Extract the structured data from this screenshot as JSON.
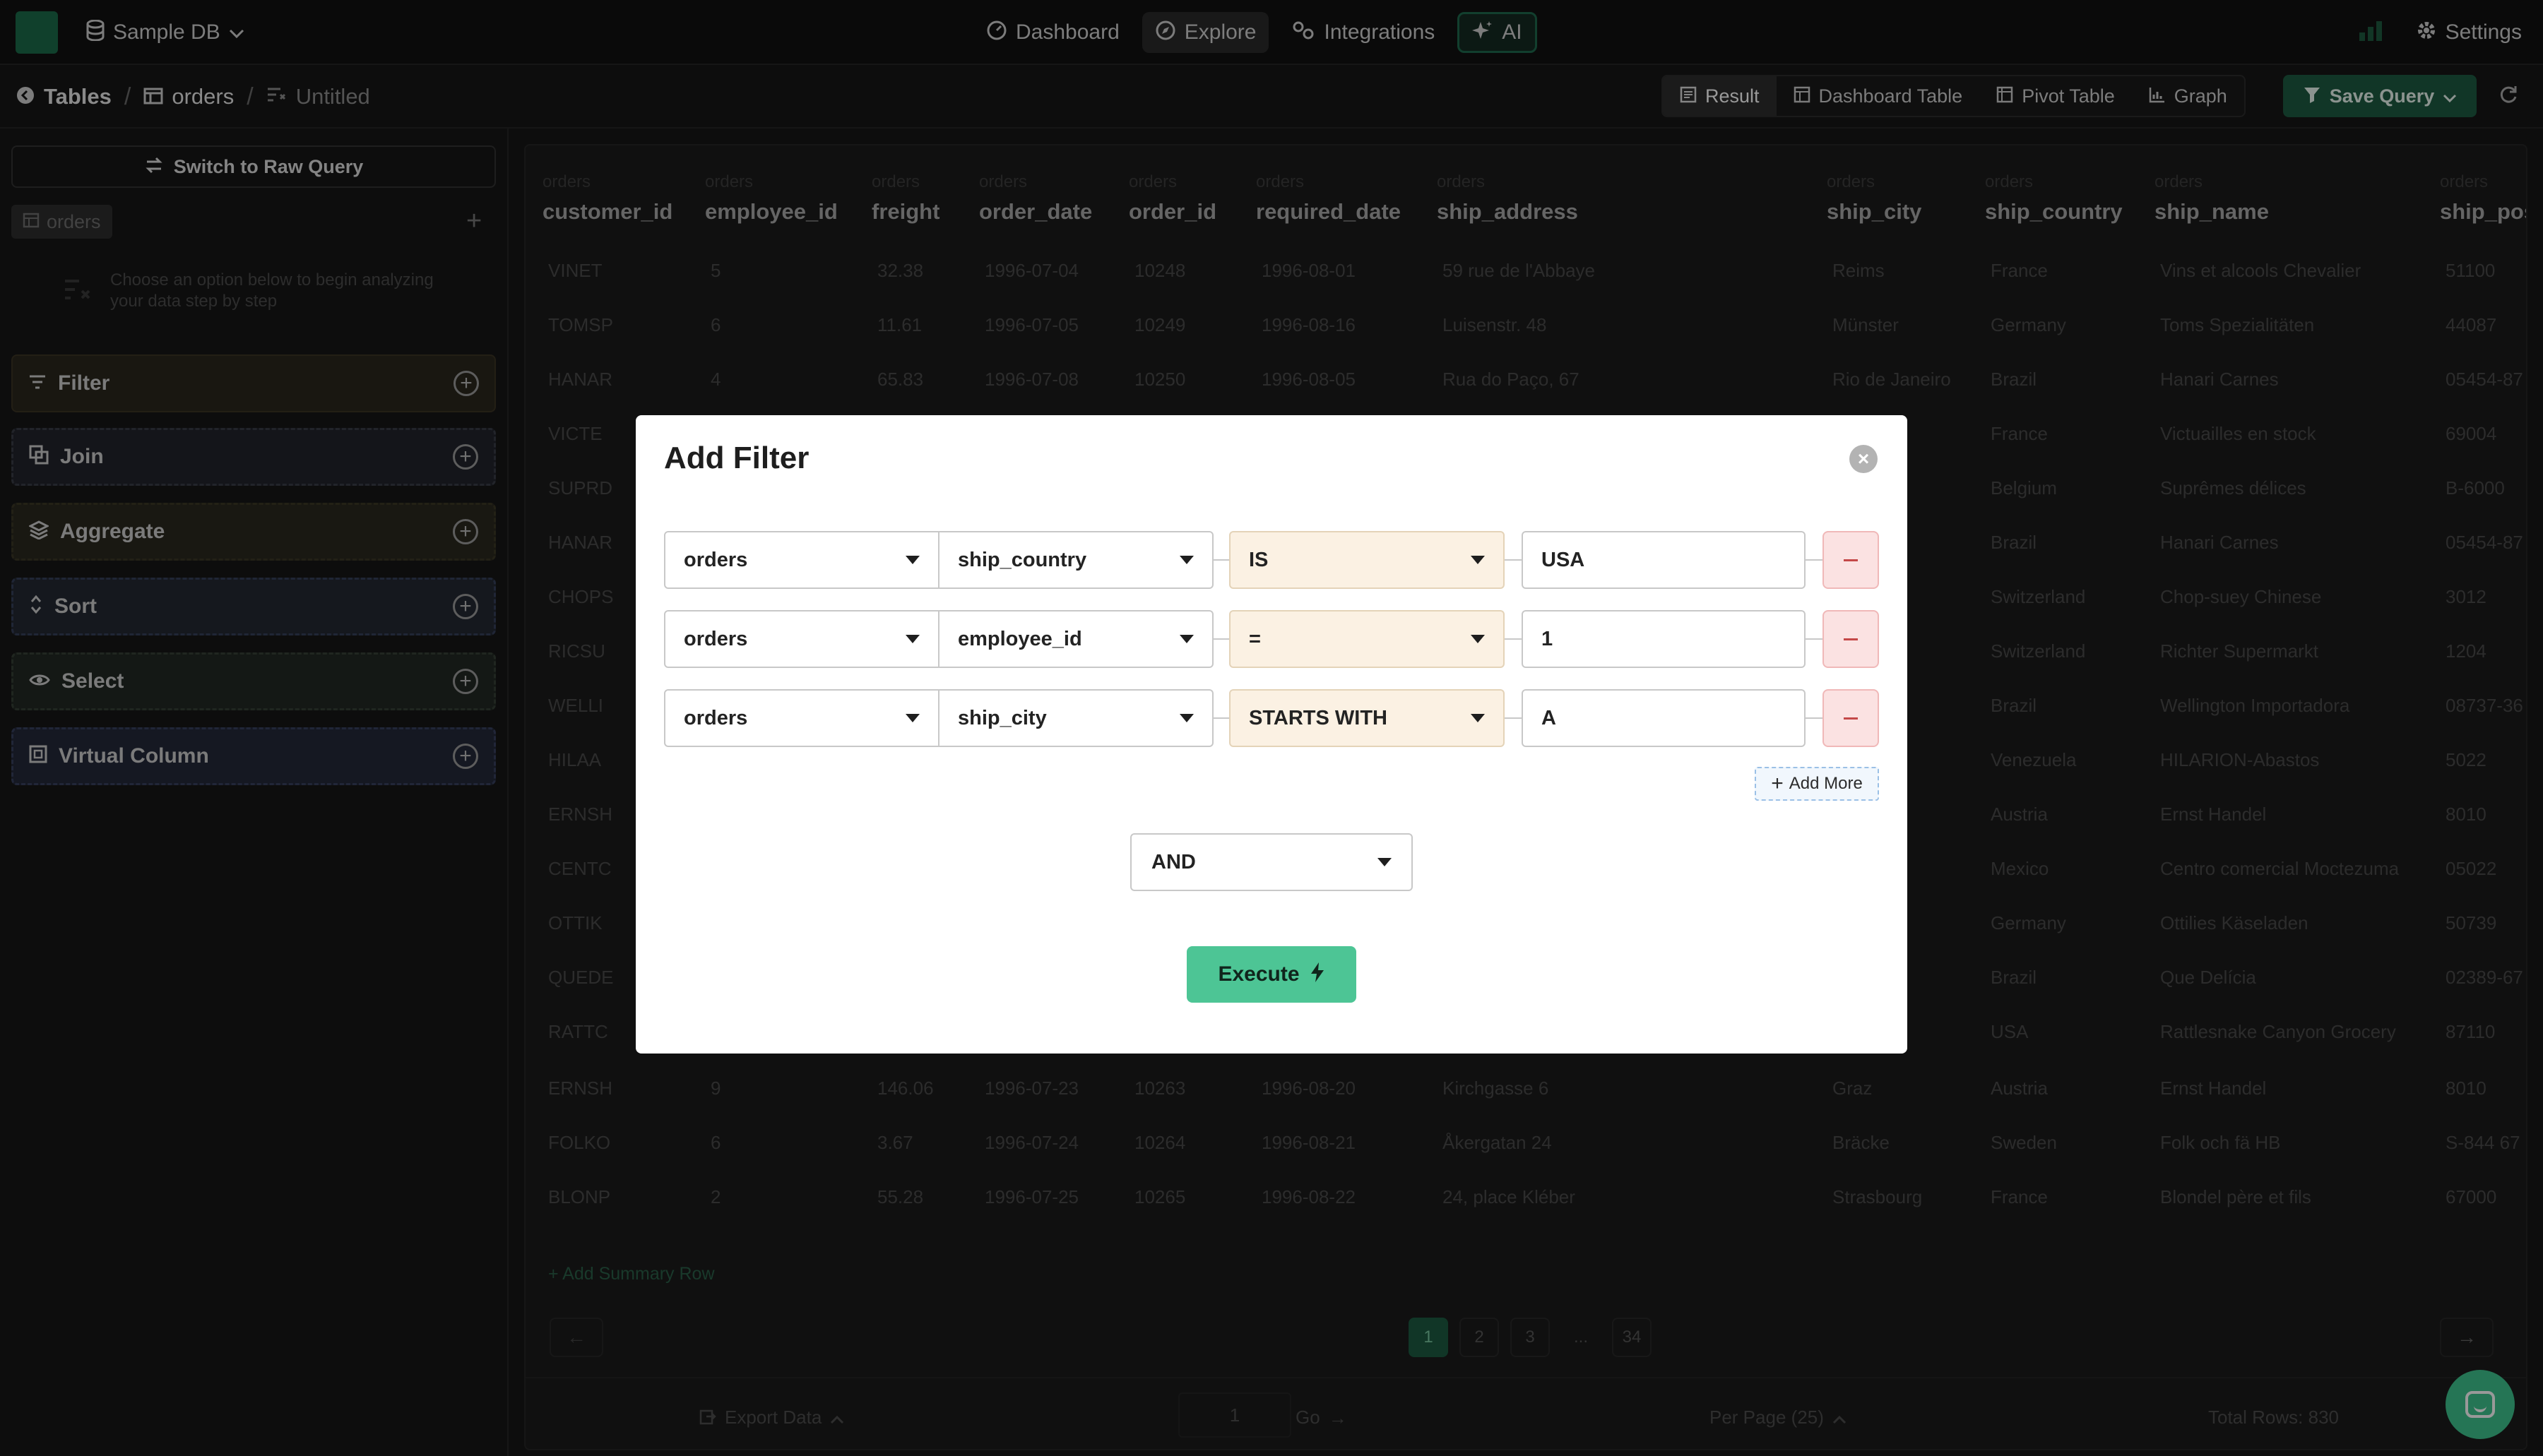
{
  "app": {
    "db_name": "Sample DB",
    "nav": [
      {
        "label": "Dashboard",
        "icon": "dashboard-icon"
      },
      {
        "label": "Explore",
        "icon": "compass-icon"
      },
      {
        "label": "Integrations",
        "icon": "integrations-icon"
      },
      {
        "label": "AI",
        "icon": "sparkle-icon"
      }
    ],
    "settings_label": "Settings"
  },
  "subheader": {
    "breadcrumb": [
      "Tables",
      "orders",
      "Untitled"
    ],
    "view_tabs": [
      "Result",
      "Dashboard Table",
      "Pivot Table",
      "Graph"
    ],
    "save_label": "Save Query"
  },
  "left_panel": {
    "raw_query_label": "Switch to Raw Query",
    "table_pill": "orders",
    "hint": "Choose an option below to begin analyzing your data step by step",
    "operations": [
      "Filter",
      "Join",
      "Aggregate",
      "Sort",
      "Select",
      "Virtual Column"
    ]
  },
  "table": {
    "source": "orders",
    "columns": [
      "customer_id",
      "employee_id",
      "freight",
      "order_date",
      "order_id",
      "required_date",
      "ship_address",
      "ship_city",
      "ship_country",
      "ship_name",
      "ship_pos"
    ],
    "rows": [
      [
        "VINET",
        "5",
        "32.38",
        "1996-07-04",
        "10248",
        "1996-08-01",
        "59 rue de l'Abbaye",
        "Reims",
        "France",
        "Vins et alcools Chevalier",
        "51100"
      ],
      [
        "TOMSP",
        "6",
        "11.61",
        "1996-07-05",
        "10249",
        "1996-08-16",
        "Luisenstr. 48",
        "Münster",
        "Germany",
        "Toms Spezialitäten",
        "44087"
      ],
      [
        "HANAR",
        "4",
        "65.83",
        "1996-07-08",
        "10250",
        "1996-08-05",
        "Rua do Paço, 67",
        "Rio de Janeiro",
        "Brazil",
        "Hanari Carnes",
        "05454-87"
      ],
      [
        "VICTE",
        "",
        "",
        "",
        "",
        "",
        "",
        "",
        "France",
        "Victuailles en stock",
        "69004"
      ],
      [
        "SUPRD",
        "",
        "",
        "",
        "",
        "",
        "",
        "",
        "Belgium",
        "Suprêmes délices",
        "B-6000"
      ],
      [
        "HANAR",
        "",
        "",
        "",
        "",
        "",
        "",
        "neiro",
        "Brazil",
        "Hanari Carnes",
        "05454-87"
      ],
      [
        "CHOPS",
        "",
        "",
        "",
        "",
        "",
        "",
        "",
        "Switzerland",
        "Chop-suey Chinese",
        "3012"
      ],
      [
        "RICSU",
        "",
        "",
        "",
        "",
        "",
        "",
        "",
        "Switzerland",
        "Richter Supermarkt",
        "1204"
      ],
      [
        "WELLI",
        "",
        "",
        "",
        "",
        "",
        "",
        "",
        "Brazil",
        "Wellington Importadora",
        "08737-36"
      ],
      [
        "HILAA",
        "",
        "",
        "",
        "",
        "",
        "",
        "bal",
        "Venezuela",
        "HILARION-Abastos",
        "5022"
      ],
      [
        "ERNSH",
        "",
        "",
        "",
        "",
        "",
        "",
        "",
        "Austria",
        "Ernst Handel",
        "8010"
      ],
      [
        "CENTC",
        "",
        "",
        "",
        "",
        "",
        "",
        "F.",
        "Mexico",
        "Centro comercial Moctezuma",
        "05022"
      ],
      [
        "OTTIK",
        "",
        "",
        "",
        "",
        "",
        "",
        "",
        "Germany",
        "Ottilies Käseladen",
        "50739"
      ],
      [
        "QUEDE",
        "",
        "",
        "",
        "",
        "",
        "",
        "neiro",
        "Brazil",
        "Que Delícia",
        "02389-67"
      ],
      [
        "RATTC",
        "",
        "",
        "",
        "",
        "",
        "",
        "que",
        "USA",
        "Rattlesnake Canyon Grocery",
        "87110"
      ],
      [
        "ERNSH",
        "9",
        "146.06",
        "1996-07-23",
        "10263",
        "1996-08-20",
        "Kirchgasse 6",
        "Graz",
        "Austria",
        "Ernst Handel",
        "8010"
      ],
      [
        "FOLKO",
        "6",
        "3.67",
        "1996-07-24",
        "10264",
        "1996-08-21",
        "Åkergatan 24",
        "Bräcke",
        "Sweden",
        "Folk och fä HB",
        "S-844 67"
      ],
      [
        "BLONP",
        "2",
        "55.28",
        "1996-07-25",
        "10265",
        "1996-08-22",
        "24, place Kléber",
        "Strasbourg",
        "France",
        "Blondel père et fils",
        "67000"
      ]
    ],
    "add_summary": "+ Add Summary Row",
    "pages": [
      "1",
      "2",
      "3",
      "...",
      "34"
    ],
    "export_label": "Export Data",
    "page_input": "1",
    "go_label": "Go",
    "per_page_label": "Per Page (25)",
    "total_rows_label": "Total Rows: 830"
  },
  "modal": {
    "title": "Add Filter",
    "filters": [
      {
        "table": "orders",
        "column": "ship_country",
        "operator": "IS",
        "value": "USA"
      },
      {
        "table": "orders",
        "column": "employee_id",
        "operator": "=",
        "value": "1"
      },
      {
        "table": "orders",
        "column": "ship_city",
        "operator": "STARTS WITH",
        "value": "A"
      }
    ],
    "add_more_label": "Add More",
    "logic": "AND",
    "execute_label": "Execute"
  },
  "colors": {
    "accent": "#4dc595",
    "brand_dark": "#1d5a41",
    "operator_bg": "#fbf1e3",
    "delete_bg": "#fbe2e2"
  }
}
